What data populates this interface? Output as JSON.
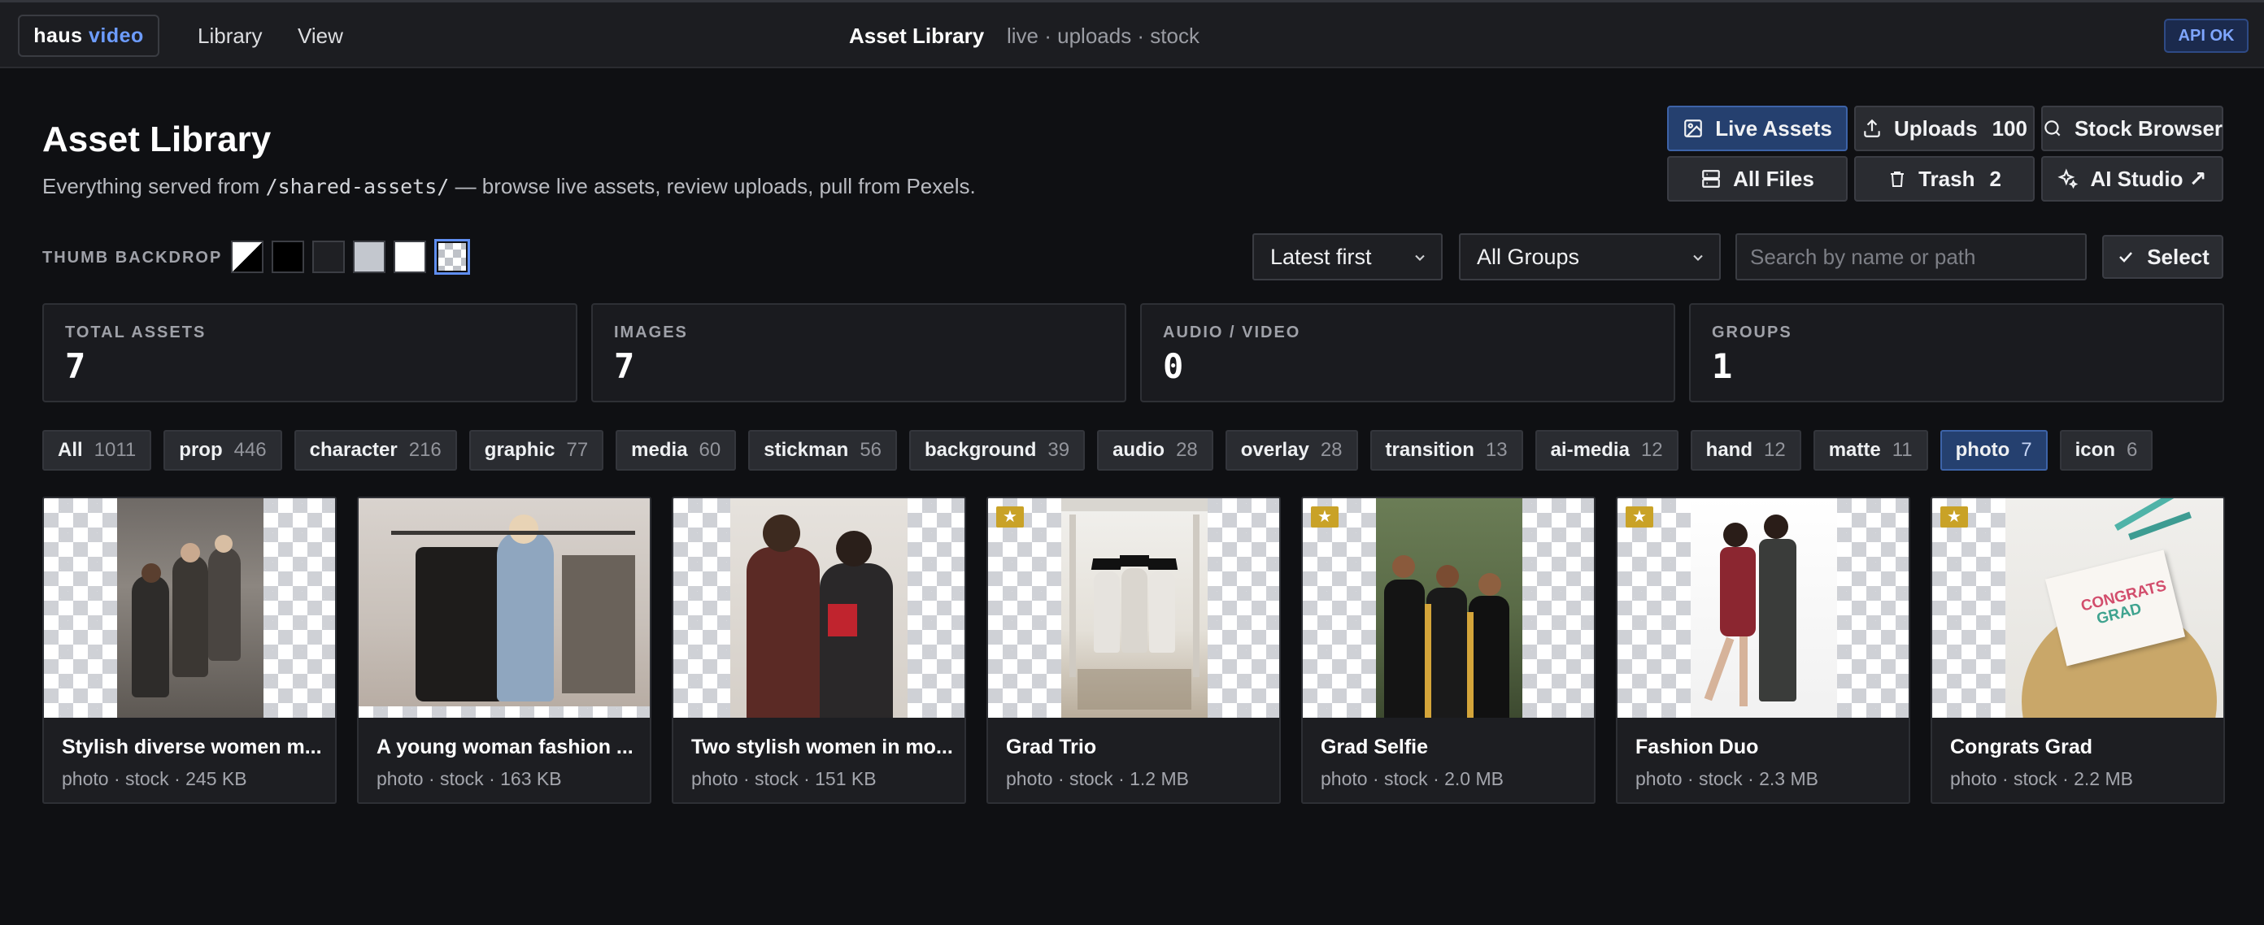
{
  "topbar": {
    "logo_main": "haus",
    "logo_accent": "video",
    "nav": [
      "Library",
      "View"
    ],
    "title": "Asset Library",
    "subtitle": "live · uploads · stock",
    "status_badge": "API OK"
  },
  "header": {
    "title": "Asset Library",
    "desc_before": "Everything served from ",
    "desc_path": "/shared-assets/",
    "desc_after": " — browse live assets, review uploads, pull from Pexels."
  },
  "actions": {
    "live_assets": "Live Assets",
    "uploads": "Uploads",
    "uploads_count": "100",
    "stock_browser": "Stock Browser",
    "all_files": "All Files",
    "trash": "Trash",
    "trash_count": "2",
    "ai_studio": "AI Studio ↗"
  },
  "toolbar": {
    "backdrop_label": "THUMB BACKDROP",
    "sort_value": "Latest first",
    "group_value": "All Groups",
    "search_placeholder": "Search by name or path",
    "select_label": "Select"
  },
  "stats": [
    {
      "label": "TOTAL ASSETS",
      "value": "7"
    },
    {
      "label": "IMAGES",
      "value": "7"
    },
    {
      "label": "AUDIO / VIDEO",
      "value": "0"
    },
    {
      "label": "GROUPS",
      "value": "1"
    }
  ],
  "chips": [
    {
      "name": "All",
      "count": "1011"
    },
    {
      "name": "prop",
      "count": "446"
    },
    {
      "name": "character",
      "count": "216"
    },
    {
      "name": "graphic",
      "count": "77"
    },
    {
      "name": "media",
      "count": "60"
    },
    {
      "name": "stickman",
      "count": "56"
    },
    {
      "name": "background",
      "count": "39"
    },
    {
      "name": "audio",
      "count": "28"
    },
    {
      "name": "overlay",
      "count": "28"
    },
    {
      "name": "transition",
      "count": "13"
    },
    {
      "name": "ai-media",
      "count": "12"
    },
    {
      "name": "hand",
      "count": "12"
    },
    {
      "name": "matte",
      "count": "11"
    },
    {
      "name": "photo",
      "count": "7"
    },
    {
      "name": "icon",
      "count": "6"
    }
  ],
  "active_chip": "photo",
  "assets": [
    {
      "title": "Stylish diverse women m...",
      "meta": "photo · stock · 245 KB",
      "starred": false
    },
    {
      "title": "A young woman fashion ...",
      "meta": "photo · stock · 163 KB",
      "starred": false
    },
    {
      "title": "Two stylish women in mo...",
      "meta": "photo · stock · 151 KB",
      "starred": false
    },
    {
      "title": "Grad Trio",
      "meta": "photo · stock · 1.2 MB",
      "starred": true
    },
    {
      "title": "Grad Selfie",
      "meta": "photo · stock · 2.0 MB",
      "starred": true
    },
    {
      "title": "Fashion Duo",
      "meta": "photo · stock · 2.3 MB",
      "starred": true
    },
    {
      "title": "Congrats Grad",
      "meta": "photo · stock · 2.2 MB",
      "starred": true
    }
  ],
  "colors": {
    "accent": "#6d9cff",
    "active_bg": "#25406f",
    "star": "#c9a227"
  }
}
